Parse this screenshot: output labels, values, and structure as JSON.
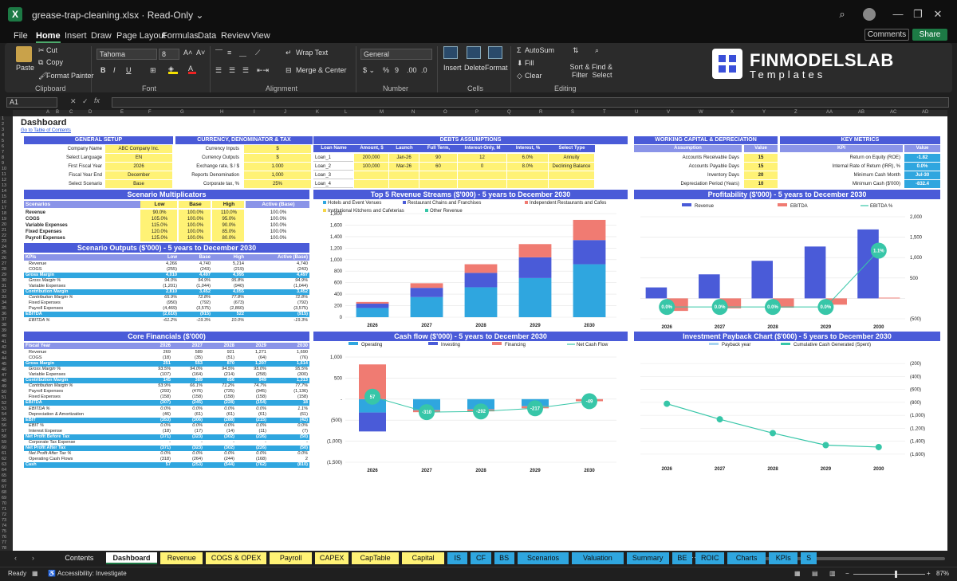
{
  "window": {
    "file": "grease-trap-cleaning.xlsx",
    "mode": "Read-Only"
  },
  "menu": [
    "File",
    "Home",
    "Insert",
    "Draw",
    "Page Layout",
    "Formulas",
    "Data",
    "Review",
    "View"
  ],
  "menu_right": {
    "comments": "Comments",
    "share": "Share"
  },
  "ribbon": {
    "paste": "Paste",
    "cut": "Cut",
    "copy": "Copy",
    "format_painter": "Format Painter",
    "clipboard": "Clipboard",
    "font_name": "Tahoma",
    "font_size": "8",
    "font": "Font",
    "wrap": "Wrap Text",
    "merge": "Merge & Center",
    "alignment": "Alignment",
    "number_format": "General",
    "number": "Number",
    "insert": "Insert",
    "delete": "Delete",
    "format": "Format",
    "cells": "Cells",
    "autosum": "AutoSum",
    "fill": "Fill",
    "clear": "Clear",
    "sort": "Sort & Filter",
    "find": "Find & Select",
    "editing": "Editing"
  },
  "brand": {
    "name": "FINMODELSLAB",
    "sub": "Templates"
  },
  "namebox": "A1",
  "colLetters": [
    "A",
    "B",
    "C",
    "D",
    "E",
    "F",
    "G",
    "H",
    "I",
    "J",
    "K",
    "L",
    "M",
    "N",
    "O",
    "P",
    "Q",
    "R",
    "S",
    "T",
    "U",
    "V",
    "W",
    "X",
    "Y",
    "Z",
    "AA",
    "AB",
    "AC",
    "AD"
  ],
  "dashboard": {
    "title": "Dashboard",
    "link": "Go to Table of Contents"
  },
  "general": {
    "title": "GENERAL SETUP",
    "rows": [
      [
        "Company Name",
        "ABC Company Inc."
      ],
      [
        "Select Language",
        "EN"
      ],
      [
        "First Fiscal Year",
        "2026"
      ],
      [
        "Fiscal Year End",
        "December"
      ],
      [
        "Select Scenario",
        "Base"
      ]
    ]
  },
  "currency": {
    "title": "CURRENCY, DENOMINATOR & TAX",
    "rows": [
      [
        "Currency Inputs",
        "$"
      ],
      [
        "Currency Outputs",
        "$"
      ],
      [
        "Exchange rate, $ / $",
        "1.000"
      ],
      [
        "Reports Denomination",
        "1,000"
      ],
      [
        "Corporate tax, %",
        "25%"
      ]
    ]
  },
  "debts": {
    "title": "DEBTS ASSUMPTIONS",
    "headers": [
      "Loan Name",
      "Amount, $",
      "Launch",
      "Full Term, Months",
      "Interest-Only, M",
      "Interest, %",
      "Select Type"
    ],
    "rows": [
      [
        "Loan_1",
        "200,000",
        "Jan-26",
        "90",
        "12",
        "6.0%",
        "Annuity"
      ],
      [
        "Loan_2",
        "100,000",
        "Mar-26",
        "60",
        "0",
        "8.0%",
        "Declining Balance"
      ],
      [
        "Loan_3",
        "",
        "",
        "",
        "",
        "",
        ""
      ],
      [
        "Loan_4",
        "",
        "",
        "",
        "",
        "",
        ""
      ]
    ]
  },
  "wc": {
    "title": "WORKING CAPITAL & DEPRECIATION",
    "headers": [
      "Assumption",
      "Value"
    ],
    "rows": [
      [
        "Accounts Receivable Days",
        "15"
      ],
      [
        "Accounts Payable Days",
        "15"
      ],
      [
        "Inventory Days",
        "20"
      ],
      [
        "Depreciation Period (Years)",
        "10"
      ]
    ]
  },
  "kpi": {
    "title": "KEY METRICS",
    "headers": [
      "KPI",
      "Value"
    ],
    "rows": [
      [
        "Return on Equity (ROE)",
        "-1.82"
      ],
      [
        "Internal Rate of Return (IRR), %",
        "0.0%"
      ],
      [
        "Minimum Cash Month",
        "Jul-30"
      ],
      [
        "Minimum Cash ($'000)",
        "-832.4"
      ]
    ]
  },
  "multipliers": {
    "title": "Scenario Multiplicators",
    "headers": [
      "Scenarios",
      "Low",
      "Base",
      "High",
      "Active (Base)"
    ],
    "rows": [
      [
        "Revenue",
        "90.0%",
        "100.0%",
        "110.0%",
        "100.0%"
      ],
      [
        "COGS",
        "105.0%",
        "100.0%",
        "95.0%",
        "100.0%"
      ],
      [
        "Variable Expenses",
        "115.0%",
        "100.0%",
        "90.0%",
        "100.0%"
      ],
      [
        "Fixed Expenses",
        "120.0%",
        "100.0%",
        "85.0%",
        "100.0%"
      ],
      [
        "Payroll Expenses",
        "125.0%",
        "100.0%",
        "80.0%",
        "100.0%"
      ]
    ]
  },
  "outputs": {
    "title": "Scenario Outputs ($'000) - 5 years to December 2030",
    "headers": [
      "KPIs",
      "Low",
      "Base",
      "High",
      "Active (Base)"
    ],
    "rows": [
      [
        "Revenue",
        "4,266",
        "4,740",
        "5,214",
        "4,740",
        ""
      ],
      [
        "COGS",
        "(255)",
        "(243)",
        "(219)",
        "(243)",
        ""
      ],
      [
        "Gross Margin",
        "4,010",
        "4,497",
        "4,995",
        "4,497",
        "hl"
      ],
      [
        "Gross Margin %",
        "94.0%",
        "94.9%",
        "95.8%",
        "94.9%",
        "it"
      ],
      [
        "Variable Expenses",
        "(1,201)",
        "(1,044)",
        "(940)",
        "(1,044)",
        ""
      ],
      [
        "Contribution Margin",
        "2,810",
        "3,452",
        "4,055",
        "3,452",
        "hl"
      ],
      [
        "Contribution Margin %",
        "65.9%",
        "72.8%",
        "77.8%",
        "72.8%",
        "it"
      ],
      [
        "Fixed Expenses",
        "(950)",
        "(792)",
        "(673)",
        "(792)",
        ""
      ],
      [
        "Payroll Expenses",
        "(4,469)",
        "(3,575)",
        "(2,860)",
        "(3,575)",
        ""
      ],
      [
        "EBITDA",
        "(2,610)",
        "(915)",
        "522",
        "(915)",
        "hl"
      ],
      [
        "EBITDA %",
        "-61.2%",
        "-19.3%",
        "10.0%",
        "-19.3%",
        "it"
      ]
    ]
  },
  "core": {
    "title": "Core Financials ($'000)",
    "headers": [
      "Fiscal Year",
      "2026",
      "2027",
      "2028",
      "2029",
      "2030"
    ],
    "rows": [
      [
        "Revenue",
        "269",
        "589",
        "921",
        "1,271",
        "1,690",
        ""
      ],
      [
        "COGS",
        "(18)",
        "(35)",
        "(51)",
        "(64)",
        "(76)",
        ""
      ],
      [
        "Gross Margin",
        "251",
        "553",
        "870",
        "1,207",
        "1,614",
        "hl"
      ],
      [
        "Gross Margin %",
        "93.5%",
        "94.0%",
        "94.5%",
        "95.0%",
        "95.5%",
        "it"
      ],
      [
        "Variable Expenses",
        "(107)",
        "(164)",
        "(214)",
        "(258)",
        "(300)",
        ""
      ],
      [
        "Contribution Margin",
        "145",
        "389",
        "656",
        "949",
        "1,313",
        "hl"
      ],
      [
        "Contribution Margin %",
        "53.9%",
        "66.1%",
        "71.2%",
        "74.7%",
        "77.7%",
        "it"
      ],
      [
        "Payroll Expenses",
        "(293)",
        "(476)",
        "(725)",
        "(945)",
        "(1,136)",
        ""
      ],
      [
        "Fixed Expenses",
        "(158)",
        "(158)",
        "(158)",
        "(158)",
        "(158)",
        ""
      ],
      [
        "EBITDA",
        "(307)",
        "(245)",
        "(228)",
        "(154)",
        "18",
        "hl"
      ],
      [
        "EBITDA %",
        "0.0%",
        "0.0%",
        "0.0%",
        "0.0%",
        "1.1%",
        "it"
      ],
      [
        "Depreciation & Amortization",
        "(46)",
        "(61)",
        "(61)",
        "(61)",
        "(61)",
        ""
      ],
      [
        "EBIT",
        "(353)",
        "(306)",
        "(288)",
        "(215)",
        "(42)",
        "hl"
      ],
      [
        "EBIT %",
        "0.0%",
        "0.0%",
        "0.0%",
        "0.0%",
        "0.0%",
        "it"
      ],
      [
        "Interest Expense",
        "(18)",
        "(17)",
        "(14)",
        "(11)",
        "(7)",
        ""
      ],
      [
        "Net Profit Before Tax",
        "(371)",
        "(323)",
        "(302)",
        "(226)",
        "(50)",
        "hl"
      ],
      [
        "Corporate Tax Expense",
        "-",
        "-",
        "-",
        "-",
        "-",
        ""
      ],
      [
        "Net Profit After Tax",
        "(371)",
        "(323)",
        "(302)",
        "(226)",
        "(50)",
        "hl"
      ],
      [
        "Net Profit After Tax %",
        "0.0%",
        "0.0%",
        "0.0%",
        "0.0%",
        "0.0%",
        "it"
      ],
      [
        "Operating Cash Flows",
        "(318)",
        "(264)",
        "(244)",
        "(168)",
        "2",
        ""
      ],
      [
        "Cash",
        "57",
        "(253)",
        "(544)",
        "(762)",
        "(810)",
        "hl"
      ]
    ]
  },
  "chart_data": [
    {
      "type": "bar",
      "stacked": true,
      "title": "Top 5 Revenue Streams ($'000) - 5 years to December 2030",
      "categories": [
        "2026",
        "2027",
        "2028",
        "2029",
        "2030"
      ],
      "ylim": [
        0,
        1800
      ],
      "yticks": [
        0,
        200,
        400,
        600,
        800,
        1000,
        1200,
        1400,
        1600,
        1800
      ],
      "series": [
        {
          "name": "Hotels and Event Venues",
          "color": "#2fa6df",
          "values": [
            160,
            350,
            520,
            680,
            920
          ]
        },
        {
          "name": "Restaurant Chains and Franchises",
          "color": "#4a5bd8",
          "values": [
            75,
            160,
            250,
            360,
            420
          ]
        },
        {
          "name": "Independent Restaurants and Cafes",
          "color": "#f07b72",
          "values": [
            30,
            80,
            150,
            230,
            350
          ]
        },
        {
          "name": "Institutional Kitchens and Cafeterias",
          "color": "#f5d547",
          "values": [
            0,
            0,
            0,
            0,
            0
          ]
        },
        {
          "name": "Other Revenue",
          "color": "#37c6a8",
          "values": [
            0,
            0,
            0,
            0,
            0
          ]
        }
      ]
    },
    {
      "type": "bar",
      "title": "Profitability ($'000) - 5 years to December 2030",
      "categories": [
        "2026",
        "2027",
        "2028",
        "2029",
        "2030"
      ],
      "ylim": [
        -500,
        2000
      ],
      "yticks": [
        -500,
        0,
        500,
        1000,
        1500,
        2000
      ],
      "ytick_labels": [
        "(500)",
        "",
        "500",
        "1,000",
        "1,500",
        "2,000"
      ],
      "series": [
        {
          "name": "Revenue",
          "color": "#4a5bd8",
          "values": [
            269,
            589,
            921,
            1271,
            1690
          ]
        },
        {
          "name": "EBITDA",
          "color": "#f07b72",
          "values": [
            -307,
            -245,
            -228,
            -154,
            18
          ]
        },
        {
          "name": "EBITDA %",
          "type": "line",
          "color": "#37c6a8",
          "values": [
            0.0,
            0.0,
            0.0,
            0.0,
            1.1
          ],
          "labels": [
            "0.0%",
            "0.0%",
            "0.0%",
            "0.0%",
            "1.1%"
          ]
        }
      ]
    },
    {
      "type": "bar",
      "title": "Cash flow ($'000) - 5 years to December 2030",
      "categories": [
        "2026",
        "2027",
        "2028",
        "2029",
        "2030"
      ],
      "ylim": [
        -1500,
        1000
      ],
      "yticks": [
        -1500,
        -1000,
        -500,
        0,
        500,
        1000
      ],
      "ytick_labels": [
        "(1,500)",
        "(1,000)",
        "(500)",
        "-",
        "500",
        "1,000"
      ],
      "series": [
        {
          "name": "Operating",
          "color": "#2fa6df",
          "values": [
            -318,
            -264,
            -244,
            -168,
            2
          ]
        },
        {
          "name": "Investing",
          "color": "#4a5bd8",
          "values": [
            -450,
            0,
            0,
            0,
            0
          ]
        },
        {
          "name": "Financing",
          "color": "#f07b72",
          "values": [
            825,
            -46,
            -47,
            -50,
            -50
          ]
        },
        {
          "name": "Net Cash Flow",
          "type": "line",
          "color": "#37c6a8",
          "values": [
            57,
            -310,
            -292,
            -217,
            -49
          ]
        }
      ]
    },
    {
      "type": "line",
      "title": "Investment Payback Chart ($'000) - 5 years to December 2030",
      "categories": [
        "2026",
        "2027",
        "2028",
        "2029",
        "2030"
      ],
      "ylim": [
        -1600,
        0
      ],
      "yticks": [
        -200,
        -400,
        -600,
        -800,
        -1000,
        -1200,
        -1400,
        -1600
      ],
      "ytick_labels": [
        "(200)",
        "(400)",
        "(600)",
        "(800)",
        "(1,000)",
        "(1,200)",
        "(1,400)",
        "(1,600)"
      ],
      "series": [
        {
          "name": "Payback year",
          "color": "#a8d4f0",
          "values": []
        },
        {
          "name": "Cumulative Cash Generated (Spent)",
          "color": "#37c6a8",
          "values": [
            -821,
            -1061,
            -1275,
            -1460,
            -1490
          ]
        }
      ]
    }
  ],
  "tabs": [
    [
      "Contents",
      "#1f1f1f",
      "#eee"
    ],
    [
      "Dashboard",
      "#ffffff",
      "#111"
    ],
    [
      "Revenue",
      "#fff275",
      "#111"
    ],
    [
      "COGS & OPEX",
      "#fff275",
      "#111"
    ],
    [
      "Payroll",
      "#fff275",
      "#111"
    ],
    [
      "CAPEX",
      "#fff275",
      "#111"
    ],
    [
      "CapTable",
      "#fff275",
      "#111"
    ],
    [
      "Capital",
      "#fff275",
      "#111"
    ],
    [
      "IS",
      "#2fa6df",
      "#111"
    ],
    [
      "CF",
      "#2fa6df",
      "#111"
    ],
    [
      "BS",
      "#2fa6df",
      "#111"
    ],
    [
      "Scenarios",
      "#2fa6df",
      "#111"
    ],
    [
      "Valuation",
      "#2fa6df",
      "#111"
    ],
    [
      "Summary",
      "#2fa6df",
      "#111"
    ],
    [
      "BE",
      "#2fa6df",
      "#111"
    ],
    [
      "ROIC",
      "#2fa6df",
      "#111"
    ],
    [
      "Charts",
      "#2fa6df",
      "#111"
    ],
    [
      "KPIs",
      "#2fa6df",
      "#111"
    ],
    [
      "S",
      "#2fa6df",
      "#111"
    ]
  ],
  "status": {
    "ready": "Ready",
    "accessibility": "Accessibility: Investigate",
    "zoom": "87%"
  }
}
